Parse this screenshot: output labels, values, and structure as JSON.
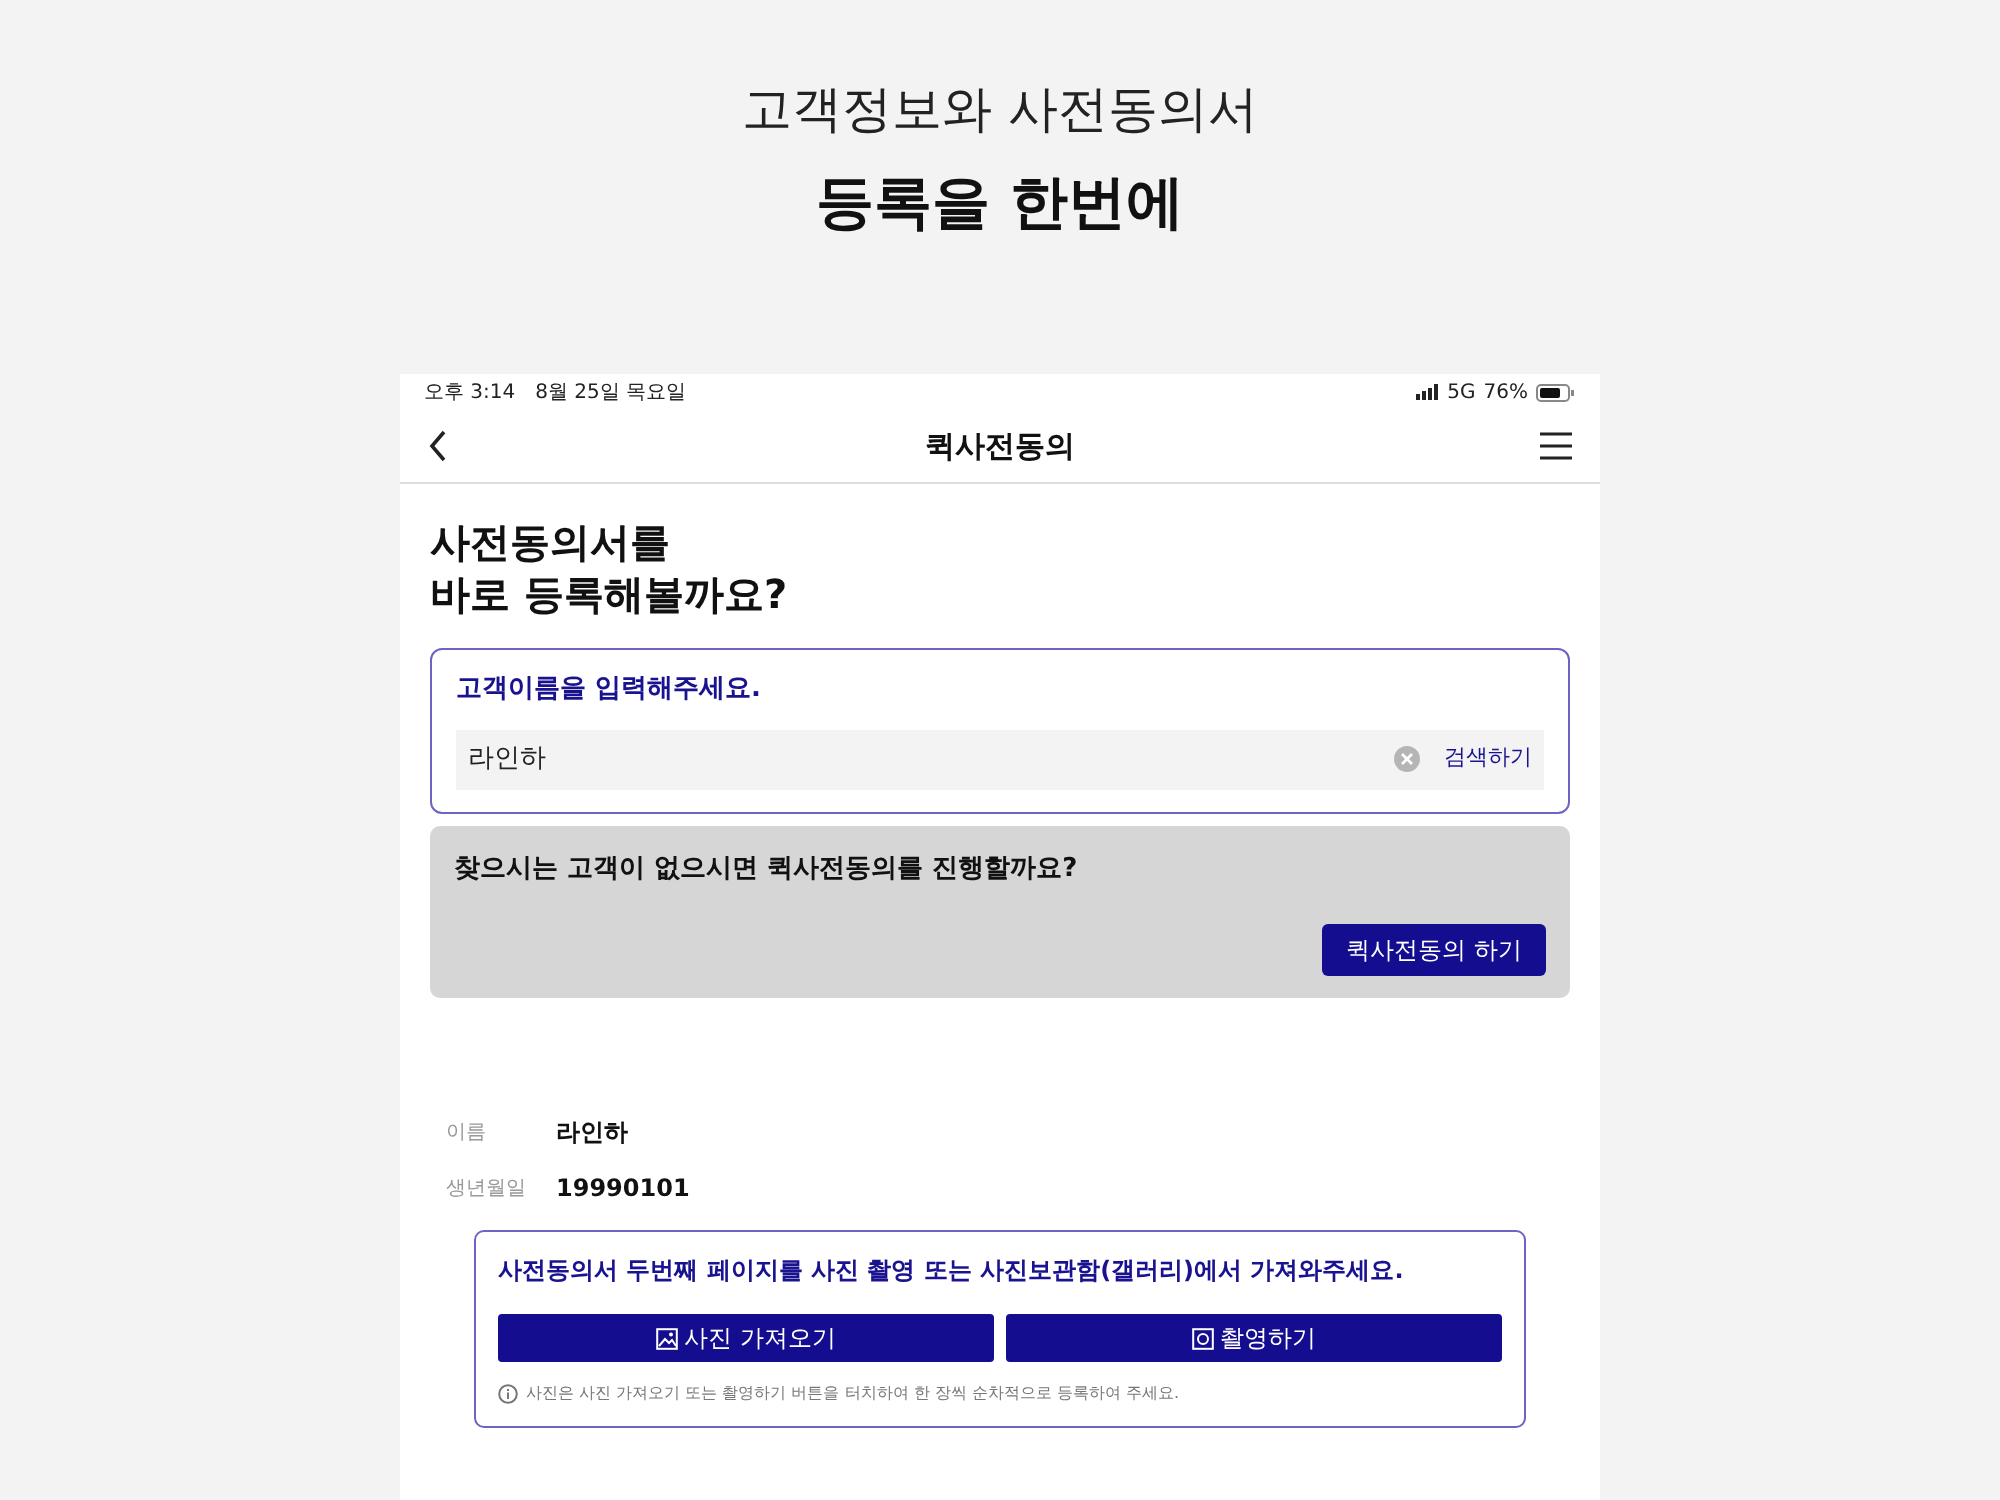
{
  "headline": {
    "line_1": "고객정보와 사전동의서",
    "line_2": "등록을 한번에"
  },
  "status_bar": {
    "time": "오후 3:14",
    "date": "8월 25일 목요일",
    "network": "5G",
    "battery": "76%"
  },
  "nav_bar": {
    "title": "퀵사전동의"
  },
  "heading": {
    "line_1": "사전동의서를",
    "line_2": "바로 등록해볼까요?"
  },
  "search_card": {
    "label": "고객이름을 입력해주세요.",
    "value": "라인하",
    "search_button": "검색하기"
  },
  "quick_card": {
    "message": "찾으시는 고객이 없으시면 퀵사전동의를 진행할까요?",
    "button": "퀵사전동의 하기"
  },
  "customer": [
    {
      "label": "이름",
      "value": "라인하"
    },
    {
      "label": "생년월일",
      "value": "19990101"
    }
  ],
  "upload_card": {
    "instruction": "사전동의서 두번째 페이지를 사진 촬영 또는 사진보관함(갤러리)에서 가져와주세요.",
    "buttons": [
      {
        "kind": "gallery",
        "label": "사진 가져오기"
      },
      {
        "kind": "camera",
        "label": "촬영하기"
      }
    ],
    "note": "사진은 사진 가져오기 또는 촬영하기 버튼을 터치하여 한 장씩 순차적으로 등록하여 주세요."
  }
}
